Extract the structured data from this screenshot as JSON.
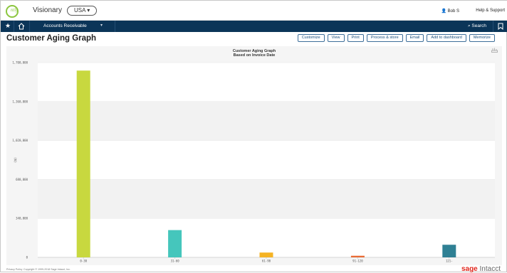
{
  "header": {
    "logo_text": "ntly",
    "company": "Visionary",
    "entity": "USA",
    "user": "Bob S",
    "help": "Help & Support"
  },
  "nav": {
    "module": "Accounts Receivable",
    "search": "Search"
  },
  "page": {
    "title": "Customer Aging Graph",
    "toolbar": [
      "Customize",
      "View",
      "Print",
      "Process & store",
      "Email",
      "Add to dashboard",
      "Memorize"
    ]
  },
  "colors": {
    "nav_bg": "#0b3558",
    "button_text": "#1a4e7d",
    "brand_red": "#e1261c"
  },
  "chart_data": {
    "type": "bar",
    "title": "Customer Aging Graph",
    "subtitle": "Based on Invoice Date",
    "ylabel": "($)",
    "xlabel": "",
    "ylim": [
      0,
      1700000
    ],
    "yticks": [
      0,
      340000,
      680000,
      1020000,
      1360000,
      1700000
    ],
    "ytick_labels": [
      "0",
      "340,000",
      "680,000",
      "1,020,000",
      "1,360,000",
      "1,700,000"
    ],
    "categories": [
      "0-30",
      "31-60",
      "61-90",
      "91-120",
      "121-"
    ],
    "values": [
      1630000,
      238000,
      42000,
      14000,
      110000
    ],
    "colors": [
      "#c8d83f",
      "#45c6bc",
      "#f5b324",
      "#e96b35",
      "#2f8094"
    ],
    "grid": "horizontal bands",
    "legend": "none"
  },
  "footer": {
    "privacy": "Privacy Policy",
    "copyright": "Copyright © 1999-2018 Sage Intacct, Inc.",
    "brand_a": "sage",
    "brand_b": "Intacct"
  }
}
